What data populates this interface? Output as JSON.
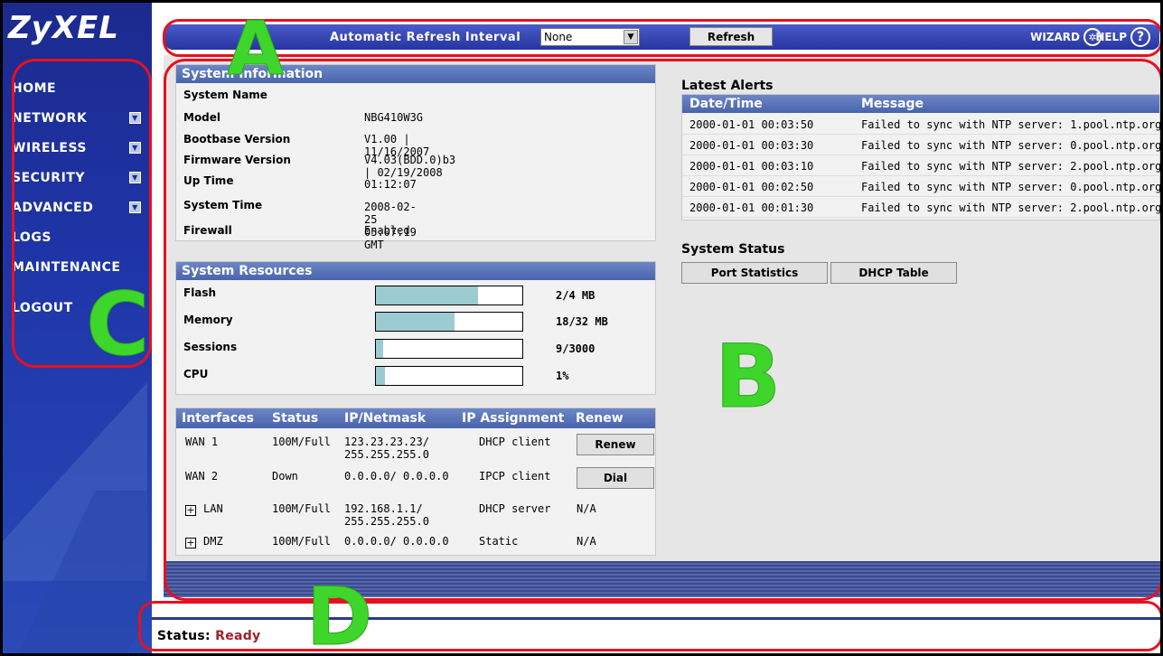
{
  "brand": {
    "logo": "ZyXEL"
  },
  "sidebar": {
    "items": [
      {
        "label": "HOME",
        "has_submenu": false
      },
      {
        "label": "NETWORK",
        "has_submenu": true
      },
      {
        "label": "WIRELESS",
        "has_submenu": true
      },
      {
        "label": "SECURITY",
        "has_submenu": true
      },
      {
        "label": "ADVANCED",
        "has_submenu": true
      },
      {
        "label": "LOGS",
        "has_submenu": false
      },
      {
        "label": "MAINTENANCE",
        "has_submenu": false
      },
      {
        "label": "LOGOUT",
        "has_submenu": false
      }
    ]
  },
  "topbar": {
    "refresh_interval_label": "Automatic Refresh Interval",
    "refresh_interval_value": "None",
    "refresh_button": "Refresh",
    "wizard_label": "WIZARD",
    "help_label": "HELP"
  },
  "system_information": {
    "title": "System Information",
    "rows": [
      {
        "label": "System Name",
        "value": ""
      },
      {
        "label": "Model",
        "value": "NBG410W3G"
      },
      {
        "label": "Bootbase Version",
        "value": "V1.00 | 11/16/2007"
      },
      {
        "label": "Firmware Version",
        "value": "V4.03(BDD.0)b3 | 02/19/2008"
      },
      {
        "label": "Up Time",
        "value": "01:12:07"
      },
      {
        "label": "System Time",
        "value": "2008-02-25 05:07:19 GMT"
      },
      {
        "label": "Firewall",
        "value": "Enabled"
      }
    ]
  },
  "system_resources": {
    "title": "System Resources",
    "rows": [
      {
        "label": "Flash",
        "value": "2/4 MB",
        "fraction": 0.7
      },
      {
        "label": "Memory",
        "value": "18/32 MB",
        "fraction": 0.54
      },
      {
        "label": "Sessions",
        "value": "9/3000",
        "fraction": 0.05
      },
      {
        "label": "CPU",
        "value": "1%",
        "fraction": 0.06
      }
    ]
  },
  "interfaces": {
    "headers": [
      "Interfaces",
      "Status",
      "IP/Netmask",
      "IP Assignment",
      "Renew"
    ],
    "rows": [
      {
        "name": "WAN 1",
        "status": "100M/Full",
        "ip1": "123.23.23.23/",
        "ip2": "255.255.255.0",
        "assign": "DHCP client",
        "renew": "Renew",
        "is_button": true,
        "expandable": false
      },
      {
        "name": "WAN 2",
        "status": "Down",
        "ip1": "0.0.0.0/ 0.0.0.0",
        "ip2": "",
        "assign": "IPCP client",
        "renew": "Dial",
        "is_button": true,
        "expandable": false
      },
      {
        "name": "LAN",
        "status": "100M/Full",
        "ip1": "192.168.1.1/",
        "ip2": "255.255.255.0",
        "assign": "DHCP server",
        "renew": "N/A",
        "is_button": false,
        "expandable": true
      },
      {
        "name": "DMZ",
        "status": "100M/Full",
        "ip1": "0.0.0.0/ 0.0.0.0",
        "ip2": "",
        "assign": "Static",
        "renew": "N/A",
        "is_button": false,
        "expandable": true
      }
    ],
    "expand_glyph": "+"
  },
  "latest_alerts": {
    "title": "Latest Alerts",
    "headers": [
      "Date/Time",
      "Message"
    ],
    "rows": [
      {
        "time": "2000-01-01 00:03:50",
        "message": "Failed to sync with NTP server: 1.pool.ntp.org"
      },
      {
        "time": "2000-01-01 00:03:30",
        "message": "Failed to sync with NTP server: 0.pool.ntp.org"
      },
      {
        "time": "2000-01-01 00:03:10",
        "message": "Failed to sync with NTP server: 2.pool.ntp.org"
      },
      {
        "time": "2000-01-01 00:02:50",
        "message": "Failed to sync with NTP server: 0.pool.ntp.org"
      },
      {
        "time": "2000-01-01 00:01:30",
        "message": "Failed to sync with NTP server: 2.pool.ntp.org"
      }
    ]
  },
  "system_status": {
    "title": "System Status",
    "port_statistics": "Port Statistics",
    "dhcp_table": "DHCP Table"
  },
  "statusbar": {
    "label": "Status:",
    "value": "Ready"
  },
  "annotations": {
    "a": "A",
    "b": "B",
    "c": "C",
    "d": "D"
  },
  "icons": {
    "submenu": "chevron-down-icon",
    "wizard": "wizard-icon",
    "help": "help-icon"
  },
  "colors": {
    "ring": "#e8101e",
    "letter": "#3ed62a",
    "sidebar": "#1c2a8e",
    "status_value": "#a0202a"
  }
}
